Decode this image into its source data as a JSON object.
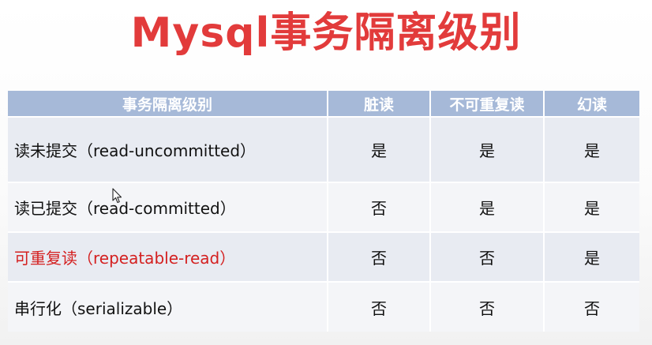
{
  "slide": {
    "title": "Mysql事务隔离级别"
  },
  "table": {
    "headers": [
      "事务隔离级别",
      "脏读",
      "不可重复读",
      "幻读"
    ],
    "rows": [
      {
        "level": "读未提交（read-uncommitted）",
        "dirty_read": "是",
        "non_repeatable_read": "是",
        "phantom_read": "是"
      },
      {
        "level": "读已提交（read-committed）",
        "dirty_read": "否",
        "non_repeatable_read": "是",
        "phantom_read": "是"
      },
      {
        "level": "可重复读（repeatable-read）",
        "dirty_read": "否",
        "non_repeatable_read": "否",
        "phantom_read": "是"
      },
      {
        "level": "串行化（serializable）",
        "dirty_read": "否",
        "non_repeatable_read": "否",
        "phantom_read": "否"
      }
    ]
  },
  "colors": {
    "title": "#e23b3b",
    "header_bg": "#a6b9d8",
    "highlight_text": "#d42020"
  }
}
